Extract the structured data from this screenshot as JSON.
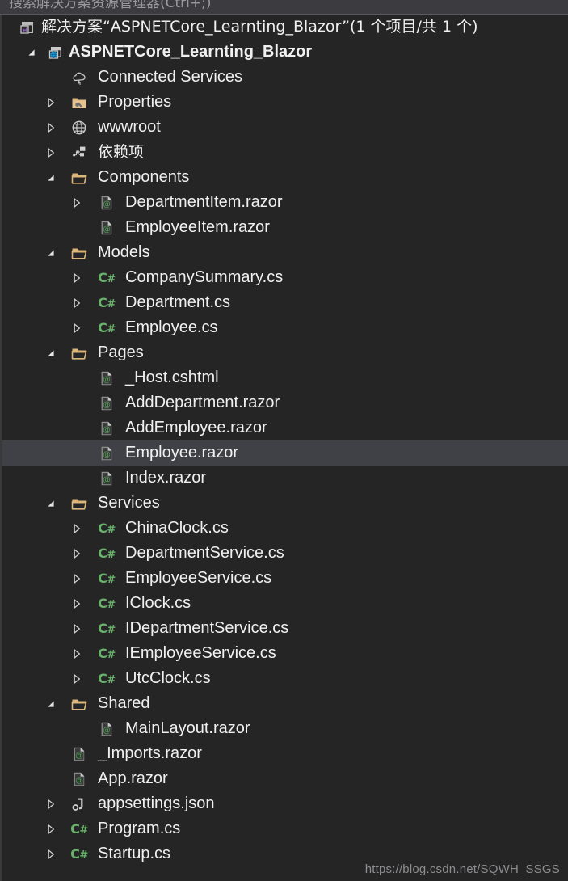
{
  "search": {
    "placeholder": "搜索解决方案资源管理器(Ctrl+;)",
    "icon": "search-icon"
  },
  "watermark": "https://blog.csdn.net/SQWH_SSGS",
  "colors": {
    "background": "#252526",
    "selection": "#3f4146",
    "text": "#f0f0f0",
    "folder": "#dcb67a",
    "csharp_green": "#68b26a",
    "razor_green": "#4f9f55",
    "project_blue": "#1ba1e2",
    "vs_purple": "#8f59c0",
    "search_bar": "#3c3c40",
    "watermark_text": "#8d8d8f"
  },
  "tree": {
    "rows": [
      {
        "label": "解决方案“ASPNETCore_Learnting_Blazor”(1 个项目/共 1 个)",
        "depth": 0,
        "icon": "solution-icon",
        "expander": "none",
        "cjk": true,
        "bold": false,
        "selected": false,
        "name": "tree-item-solution"
      },
      {
        "label": "ASPNETCore_Learnting_Blazor",
        "depth": 1,
        "icon": "project-web-icon",
        "expander": "expanded",
        "cjk": false,
        "bold": true,
        "selected": false,
        "name": "tree-item-project"
      },
      {
        "label": "Connected Services",
        "depth": 2,
        "icon": "connected-services-icon",
        "expander": "none",
        "cjk": false,
        "bold": false,
        "selected": false,
        "name": "tree-item-connected-services"
      },
      {
        "label": "Properties",
        "depth": 2,
        "icon": "folder-properties-icon",
        "expander": "collapsed",
        "cjk": false,
        "bold": false,
        "selected": false,
        "name": "tree-item-properties"
      },
      {
        "label": "wwwroot",
        "depth": 2,
        "icon": "globe-icon",
        "expander": "collapsed",
        "cjk": false,
        "bold": false,
        "selected": false,
        "name": "tree-item-wwwroot"
      },
      {
        "label": "依赖项",
        "depth": 2,
        "icon": "dependencies-icon",
        "expander": "collapsed",
        "cjk": true,
        "bold": false,
        "selected": false,
        "name": "tree-item-dependencies"
      },
      {
        "label": "Components",
        "depth": 2,
        "icon": "folder-open-icon",
        "expander": "expanded",
        "cjk": false,
        "bold": false,
        "selected": false,
        "name": "tree-item-components"
      },
      {
        "label": "DepartmentItem.razor",
        "depth": 3,
        "icon": "razor-icon",
        "expander": "collapsed",
        "cjk": false,
        "bold": false,
        "selected": false,
        "name": "tree-item-departmentitem-razor"
      },
      {
        "label": "EmployeeItem.razor",
        "depth": 3,
        "icon": "razor-icon",
        "expander": "none",
        "cjk": false,
        "bold": false,
        "selected": false,
        "name": "tree-item-employeeitem-razor"
      },
      {
        "label": "Models",
        "depth": 2,
        "icon": "folder-open-icon",
        "expander": "expanded",
        "cjk": false,
        "bold": false,
        "selected": false,
        "name": "tree-item-models"
      },
      {
        "label": "CompanySummary.cs",
        "depth": 3,
        "icon": "csharp-icon",
        "expander": "collapsed",
        "cjk": false,
        "bold": false,
        "selected": false,
        "name": "tree-item-companysummary-cs"
      },
      {
        "label": "Department.cs",
        "depth": 3,
        "icon": "csharp-icon",
        "expander": "collapsed",
        "cjk": false,
        "bold": false,
        "selected": false,
        "name": "tree-item-department-cs"
      },
      {
        "label": "Employee.cs",
        "depth": 3,
        "icon": "csharp-icon",
        "expander": "collapsed",
        "cjk": false,
        "bold": false,
        "selected": false,
        "name": "tree-item-employee-cs"
      },
      {
        "label": "Pages",
        "depth": 2,
        "icon": "folder-open-icon",
        "expander": "expanded",
        "cjk": false,
        "bold": false,
        "selected": false,
        "name": "tree-item-pages"
      },
      {
        "label": "_Host.cshtml",
        "depth": 3,
        "icon": "razor-icon",
        "expander": "none",
        "cjk": false,
        "bold": false,
        "selected": false,
        "name": "tree-item-host-cshtml"
      },
      {
        "label": "AddDepartment.razor",
        "depth": 3,
        "icon": "razor-icon",
        "expander": "none",
        "cjk": false,
        "bold": false,
        "selected": false,
        "name": "tree-item-adddepartment-razor"
      },
      {
        "label": "AddEmployee.razor",
        "depth": 3,
        "icon": "razor-icon",
        "expander": "none",
        "cjk": false,
        "bold": false,
        "selected": false,
        "name": "tree-item-addemployee-razor"
      },
      {
        "label": "Employee.razor",
        "depth": 3,
        "icon": "razor-icon",
        "expander": "none",
        "cjk": false,
        "bold": false,
        "selected": true,
        "name": "tree-item-employee-razor"
      },
      {
        "label": "Index.razor",
        "depth": 3,
        "icon": "razor-icon",
        "expander": "none",
        "cjk": false,
        "bold": false,
        "selected": false,
        "name": "tree-item-index-razor"
      },
      {
        "label": "Services",
        "depth": 2,
        "icon": "folder-open-icon",
        "expander": "expanded",
        "cjk": false,
        "bold": false,
        "selected": false,
        "name": "tree-item-services"
      },
      {
        "label": "ChinaClock.cs",
        "depth": 3,
        "icon": "csharp-icon",
        "expander": "collapsed",
        "cjk": false,
        "bold": false,
        "selected": false,
        "name": "tree-item-chinaclock-cs"
      },
      {
        "label": "DepartmentService.cs",
        "depth": 3,
        "icon": "csharp-icon",
        "expander": "collapsed",
        "cjk": false,
        "bold": false,
        "selected": false,
        "name": "tree-item-departmentservice-cs"
      },
      {
        "label": "EmployeeService.cs",
        "depth": 3,
        "icon": "csharp-icon",
        "expander": "collapsed",
        "cjk": false,
        "bold": false,
        "selected": false,
        "name": "tree-item-employeeservice-cs"
      },
      {
        "label": "IClock.cs",
        "depth": 3,
        "icon": "csharp-icon",
        "expander": "collapsed",
        "cjk": false,
        "bold": false,
        "selected": false,
        "name": "tree-item-iclock-cs"
      },
      {
        "label": "IDepartmentService.cs",
        "depth": 3,
        "icon": "csharp-icon",
        "expander": "collapsed",
        "cjk": false,
        "bold": false,
        "selected": false,
        "name": "tree-item-idepartmentservice-cs"
      },
      {
        "label": "IEmployeeService.cs",
        "depth": 3,
        "icon": "csharp-icon",
        "expander": "collapsed",
        "cjk": false,
        "bold": false,
        "selected": false,
        "name": "tree-item-iemployeeservice-cs"
      },
      {
        "label": "UtcClock.cs",
        "depth": 3,
        "icon": "csharp-icon",
        "expander": "collapsed",
        "cjk": false,
        "bold": false,
        "selected": false,
        "name": "tree-item-utcclock-cs"
      },
      {
        "label": "Shared",
        "depth": 2,
        "icon": "folder-open-icon",
        "expander": "expanded",
        "cjk": false,
        "bold": false,
        "selected": false,
        "name": "tree-item-shared"
      },
      {
        "label": "MainLayout.razor",
        "depth": 3,
        "icon": "razor-icon",
        "expander": "none",
        "cjk": false,
        "bold": false,
        "selected": false,
        "name": "tree-item-mainlayout-razor"
      },
      {
        "label": "_Imports.razor",
        "depth": 2,
        "icon": "razor-icon",
        "expander": "none",
        "cjk": false,
        "bold": false,
        "selected": false,
        "name": "tree-item-imports-razor"
      },
      {
        "label": "App.razor",
        "depth": 2,
        "icon": "razor-icon",
        "expander": "none",
        "cjk": false,
        "bold": false,
        "selected": false,
        "name": "tree-item-app-razor"
      },
      {
        "label": "appsettings.json",
        "depth": 2,
        "icon": "json-icon",
        "expander": "collapsed",
        "cjk": false,
        "bold": false,
        "selected": false,
        "name": "tree-item-appsettings-json"
      },
      {
        "label": "Program.cs",
        "depth": 2,
        "icon": "csharp-icon",
        "expander": "collapsed",
        "cjk": false,
        "bold": false,
        "selected": false,
        "name": "tree-item-program-cs"
      },
      {
        "label": "Startup.cs",
        "depth": 2,
        "icon": "csharp-icon",
        "expander": "collapsed",
        "cjk": false,
        "bold": false,
        "selected": false,
        "name": "tree-item-startup-cs"
      }
    ]
  }
}
